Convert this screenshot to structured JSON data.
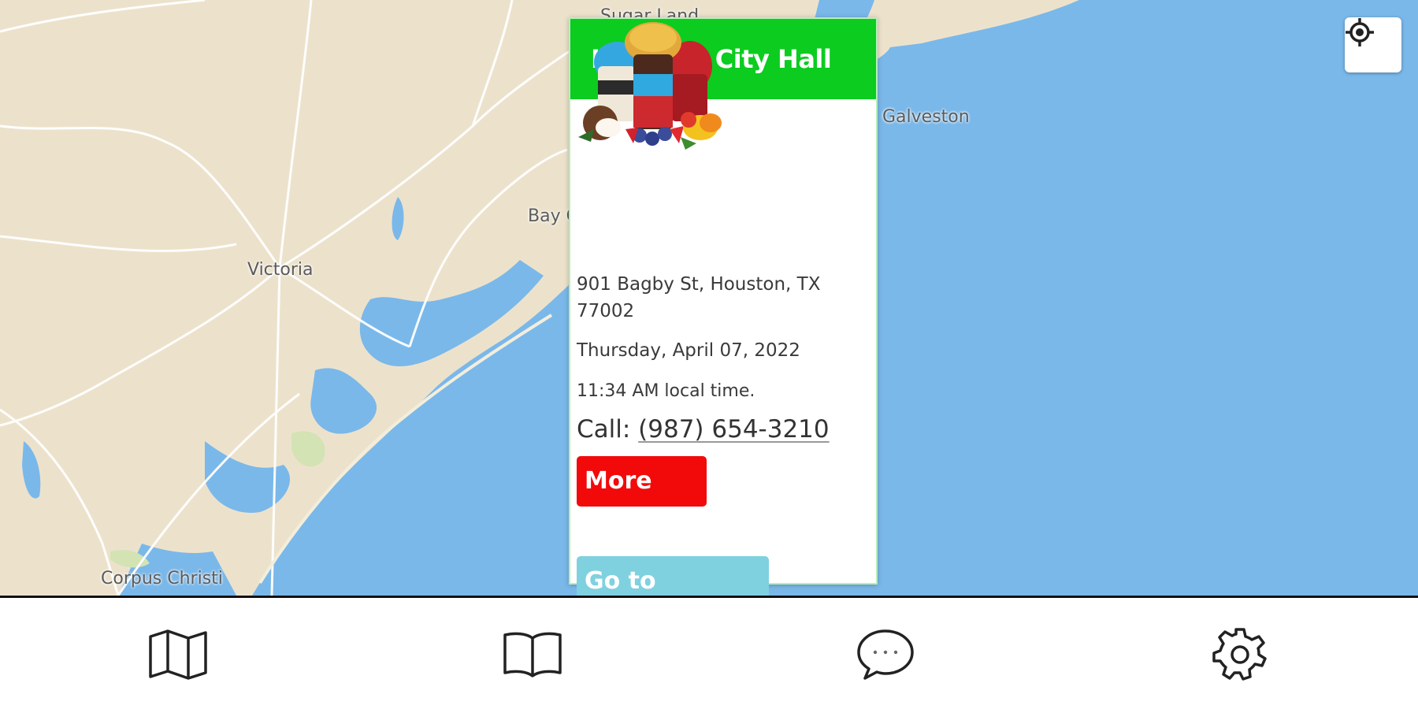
{
  "map": {
    "labels": {
      "sugar_land": "Sugar Land",
      "galveston": "Galveston",
      "bay_city": "Bay City",
      "victoria": "Victoria",
      "corpus_christi": "Corpus Christi"
    },
    "colors": {
      "land": "#ece2cc",
      "water": "#7ab8ea",
      "roads": "#ffffff",
      "park": "#d3e3b4"
    },
    "locate_icon": "crosshair-icon"
  },
  "popup": {
    "title": "Houston City Hall",
    "header_color": "#0bcc1f",
    "image": "snow-cone-treats-image",
    "address": "901 Bagby St, Houston, TX 77002",
    "date": "Thursday, April 07, 2022",
    "time": "11:34 AM local time.",
    "call_label": "Call:",
    "phone": "(987) 654-3210",
    "more_info_label": "More Info",
    "go_to_location_label": "Go to Location",
    "more_info_color": "#f20a0a",
    "go_color": "#7fd1e0"
  },
  "navbar": {
    "items": [
      {
        "icon": "map-icon"
      },
      {
        "icon": "book-icon"
      },
      {
        "icon": "chat-icon"
      },
      {
        "icon": "gear-icon"
      }
    ]
  }
}
